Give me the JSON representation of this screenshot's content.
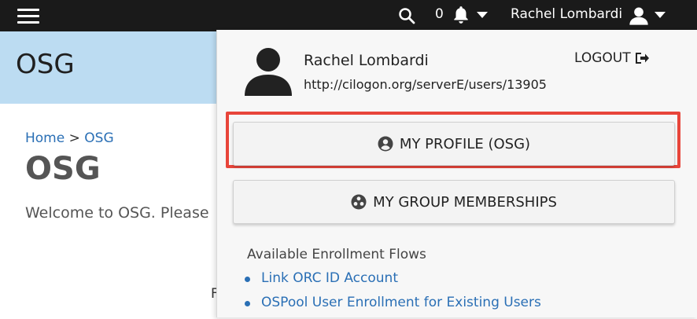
{
  "topbar": {
    "notification_count": "0",
    "user_name": "Rachel Lombardi",
    "icons": [
      "hamburger-icon",
      "search-icon",
      "bell-icon",
      "user-icon",
      "chevron-down-icon"
    ]
  },
  "banner": {
    "title": "OSG"
  },
  "breadcrumb": {
    "home": "Home",
    "separator": ">",
    "current": "OSG"
  },
  "main": {
    "title": "OSG",
    "welcome_text": "Welcome to OSG. Please",
    "partial_text": "F"
  },
  "user_menu": {
    "name": "Rachel Lombardi",
    "identifier": "http://cilogon.org/serverE/users/13905",
    "logout_label": "LOGOUT",
    "profile_button": "MY PROFILE (OSG)",
    "groups_button": "MY GROUP MEMBERSHIPS",
    "flows_heading": "Available Enrollment Flows",
    "flows": [
      {
        "label": "Link ORC ID Account"
      },
      {
        "label": "OSPool User Enrollment for Existing Users"
      }
    ]
  },
  "colors": {
    "topbar": "#1a1a1a",
    "banner": "#bcdcf2",
    "link": "#2a6fb5",
    "highlight": "#e8453a"
  }
}
